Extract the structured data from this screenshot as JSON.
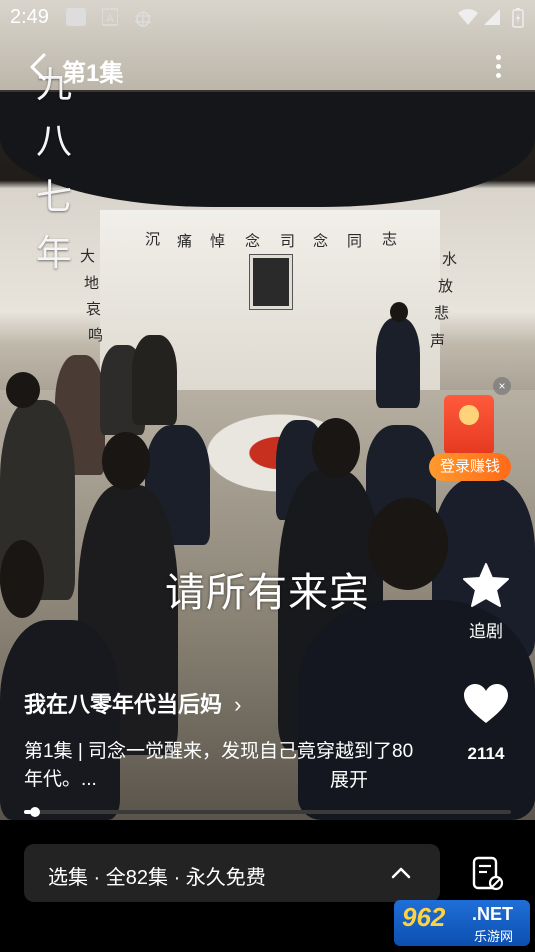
{
  "status_bar": {
    "time": "2:49",
    "icons": [
      "media-icon",
      "font-icon",
      "bug-icon",
      "wifi-icon",
      "signal-icon",
      "battery-icon"
    ]
  },
  "top_bar": {
    "back_icon": "chevron-left-icon",
    "episode_title": "第1集",
    "more_icon": "more-vertical-icon"
  },
  "video": {
    "vertical_title": [
      "九",
      "八",
      "七",
      "年"
    ],
    "banner_text": [
      "沉",
      "痛",
      "悼",
      "念",
      "司",
      "念",
      "同",
      "志"
    ],
    "left_couplet": [
      "大",
      "地",
      "哀",
      "鸣"
    ],
    "right_couplet": [
      "水",
      "放",
      "悲",
      "声"
    ],
    "subtitle": "请所有来宾"
  },
  "promo": {
    "label": "登录赚钱",
    "close": "×"
  },
  "actions": {
    "follow_label": "追剧",
    "like_count": "2114"
  },
  "drama": {
    "title": "我在八零年代当后妈",
    "title_arrow": "›",
    "description": "第1集 | 司念一觉醒来，发现自己竟穿越到了80年代。...",
    "expand_label": "展开"
  },
  "playback": {
    "progress_fraction": 0.015
  },
  "episode_bar": {
    "label": "选集 · 全82集 · 永久免费"
  },
  "watermark": {
    "number": "962",
    "suffix": ".NET",
    "cn": "乐游网"
  },
  "colors": {
    "accent_red": "#e5391f",
    "accent_orange": "#ff7a1f",
    "panel_bg": "#232323"
  }
}
